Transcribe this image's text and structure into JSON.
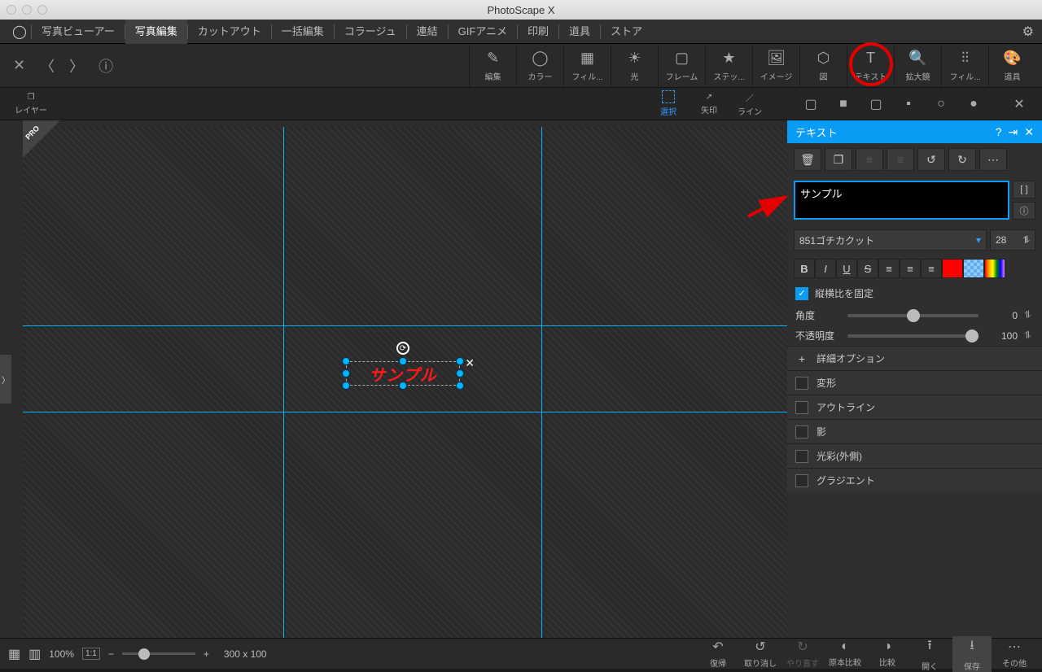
{
  "window": {
    "title": "PhotoScape X"
  },
  "menu": {
    "items": [
      "写真ビューアー",
      "写真編集",
      "カットアウト",
      "一括編集",
      "コラージュ",
      "連結",
      "GIFアニメ",
      "印刷",
      "道具",
      "ストア"
    ],
    "active_index": 1
  },
  "toolbar": {
    "items": [
      {
        "label": "編集",
        "icon": "✎"
      },
      {
        "label": "カラー",
        "icon": "◯"
      },
      {
        "label": "フィル...",
        "icon": "▦"
      },
      {
        "label": "光",
        "icon": "☀"
      },
      {
        "label": "フレーム",
        "icon": "▢"
      },
      {
        "label": "ステッ...",
        "icon": "★"
      },
      {
        "label": "イメージ",
        "icon": "🖼"
      },
      {
        "label": "図",
        "icon": "⬡"
      },
      {
        "label": "テキスト",
        "icon": "T"
      },
      {
        "label": "拡大鏡",
        "icon": "🔍"
      },
      {
        "label": "フィル...",
        "icon": "⫶⫶"
      },
      {
        "label": "道具",
        "icon": "🎨"
      }
    ],
    "highlight_index": 8
  },
  "subtoolbar": {
    "layer": "レイヤー",
    "select": "選択",
    "arrow": "矢印",
    "line": "ライン",
    "close": "✕"
  },
  "canvas": {
    "pro_badge": "PRO",
    "text_sample": "サンプル",
    "dimensions": "300 x 100"
  },
  "panel": {
    "title": "テキスト",
    "text_value": "サンプル",
    "brackets": "[   ]",
    "info": "ⓘ",
    "font": "851ゴチカクット",
    "font_size": "28",
    "lock_aspect": "縦横比を固定",
    "angle_label": "角度",
    "angle_value": "0",
    "opacity_label": "不透明度",
    "opacity_value": "100",
    "advanced": "詳細オプション",
    "options": [
      "変形",
      "アウトライン",
      "影",
      "光彩(外側)",
      "グラジエント"
    ]
  },
  "status": {
    "zoom_pct": "100%",
    "ratio": "1:1",
    "undo": "復帰",
    "undo2": "取り消し",
    "redo": "やり直す",
    "compare": "原本比較",
    "compare2": "比較",
    "open": "開く",
    "save": "保存",
    "other": "その他"
  }
}
